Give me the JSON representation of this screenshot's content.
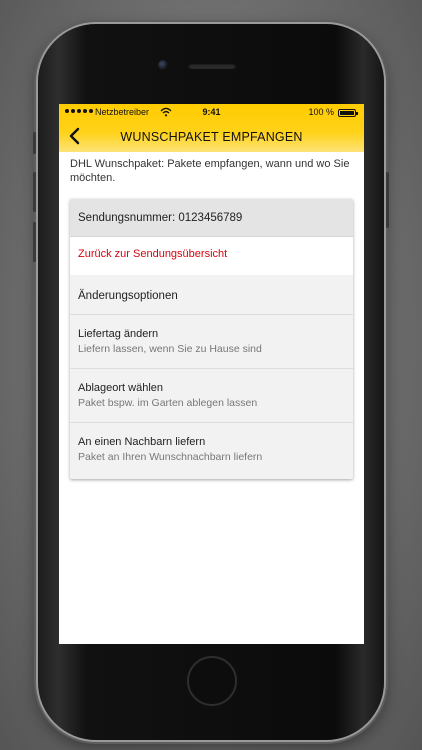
{
  "status_bar": {
    "carrier": "Netzbetreiber",
    "time": "9:41",
    "battery": "100 %"
  },
  "nav": {
    "title": "WUNSCHPAKET EMPFANGEN",
    "back_icon": "chevron-left-icon"
  },
  "intro_text": "DHL Wunschpaket: Pakete empfangen, wann und wo Sie möchten.",
  "card": {
    "header": "Sendungsnummer: 0123456789",
    "back_link": "Zurück zur Sendungsübersicht",
    "section_title": "Änderungsoptionen",
    "options": [
      {
        "title": "Liefertag ändern",
        "subtitle": "Liefern lassen, wenn Sie zu Hause sind"
      },
      {
        "title": "Ablageort wählen",
        "subtitle": "Paket bspw. im Garten ablegen lassen"
      },
      {
        "title": "An einen Nachbarn liefern",
        "subtitle": "Paket an Ihren Wunschnachbarn liefern"
      }
    ]
  },
  "colors": {
    "brand_yellow": "#ffcc00",
    "link_red": "#d40511"
  }
}
